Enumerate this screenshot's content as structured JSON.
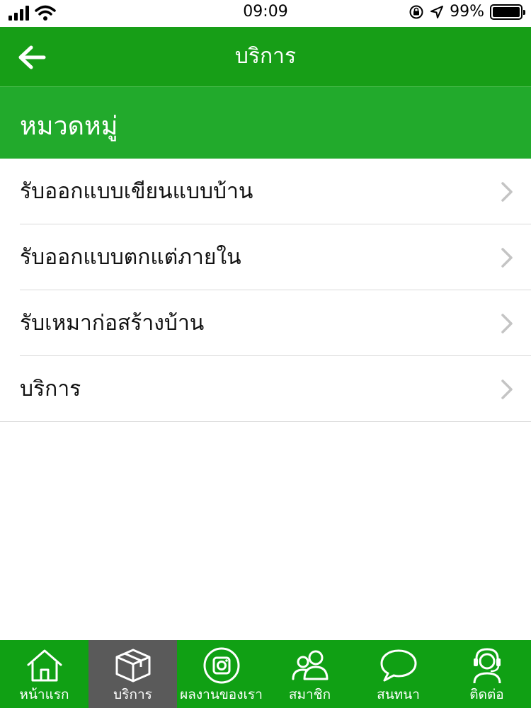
{
  "status_bar": {
    "time": "09:09",
    "battery_text": "99%",
    "battery_level": 0.99,
    "icons": [
      "signal-icon",
      "wifi-icon",
      "orientation-lock-icon",
      "location-arrow-icon",
      "battery-icon"
    ]
  },
  "nav": {
    "title": "บริการ",
    "back_icon": "arrow-left-icon"
  },
  "section": {
    "title": "หมวดหมู่"
  },
  "menu": {
    "items": [
      {
        "label": "รับออกแบบเขียนแบบบ้าน"
      },
      {
        "label": "รับออกแบบตกแต่ภายใน"
      },
      {
        "label": "รับเหมาก่อสร้างบ้าน"
      },
      {
        "label": "บริการ"
      }
    ]
  },
  "tabs": {
    "active_index": 1,
    "items": [
      {
        "label": "หน้าแรก",
        "icon": "home-icon"
      },
      {
        "label": "บริการ",
        "icon": "box-icon"
      },
      {
        "label": "ผลงานของเรา",
        "icon": "instagram-icon"
      },
      {
        "label": "สมาชิก",
        "icon": "users-icon"
      },
      {
        "label": "สนทนา",
        "icon": "chat-bubble-icon"
      },
      {
        "label": "ติดต่อ",
        "icon": "headset-icon"
      }
    ]
  },
  "colors": {
    "nav_green": "#179e17",
    "section_green": "#22aa2c",
    "tab_green": "#10a014",
    "tab_active": "#5a5a5a"
  }
}
